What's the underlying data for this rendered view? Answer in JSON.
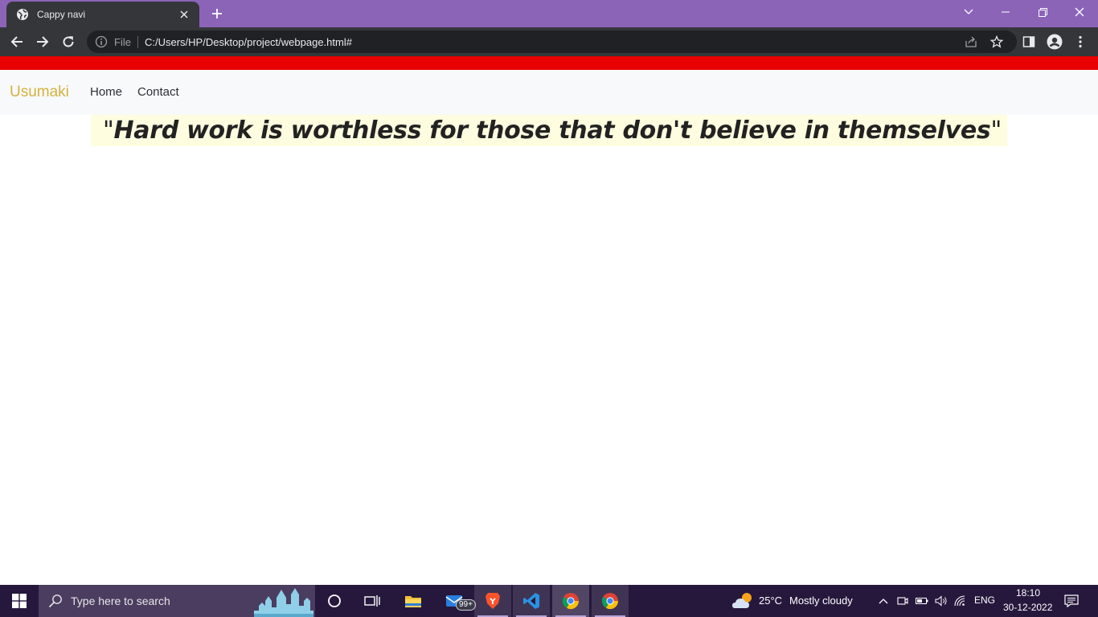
{
  "browser": {
    "tab_title": "Cappy navi",
    "url_scheme_label": "File",
    "url": "C:/Users/HP/Desktop/project/webpage.html#"
  },
  "page": {
    "brand": "Usumaki",
    "nav": [
      {
        "label": "Home"
      },
      {
        "label": "Contact"
      }
    ],
    "quote": {
      "open_mark": "\"",
      "text": "Hard work is worthless for those that don't believe in themselves",
      "close_mark": "\""
    }
  },
  "taskbar": {
    "search_placeholder": "Type here to search",
    "mail_badge": "99+",
    "weather": {
      "temp": "25°C",
      "condition": "Mostly cloudy"
    },
    "language": "ENG",
    "time": "18:10",
    "date": "30-12-2022"
  },
  "colors": {
    "tab_strip": "#8b64b8",
    "toolbar": "#35363a",
    "red_bar": "#e80000",
    "brand": "#d4b23f",
    "quote_bg": "#fffde0",
    "taskbar": "#26183d"
  }
}
